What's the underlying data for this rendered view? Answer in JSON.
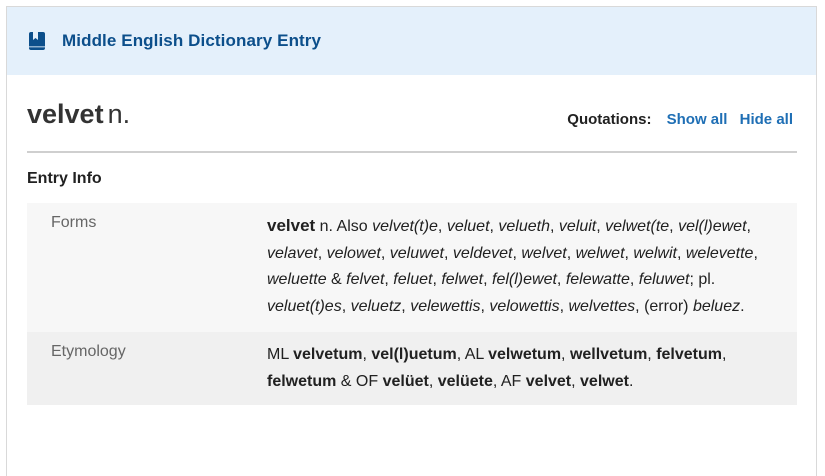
{
  "banner": {
    "title": "Middle English Dictionary Entry",
    "icon": "book-icon"
  },
  "entry": {
    "headword": "velvet",
    "pos": "n."
  },
  "quotations": {
    "label": "Quotations:",
    "show_all": "Show all",
    "hide_all": "Hide all"
  },
  "section": {
    "title": "Entry Info"
  },
  "forms": {
    "label": "Forms",
    "segments": [
      {
        "t": "velvet",
        "s": "hw"
      },
      {
        "t": " n. Also ",
        "s": "n"
      },
      {
        "t": "velvet(t)e",
        "s": "i"
      },
      {
        "t": ", ",
        "s": "n"
      },
      {
        "t": "veluet",
        "s": "i"
      },
      {
        "t": ", ",
        "s": "n"
      },
      {
        "t": "velueth",
        "s": "i"
      },
      {
        "t": ", ",
        "s": "n"
      },
      {
        "t": "veluit",
        "s": "i"
      },
      {
        "t": ", ",
        "s": "n"
      },
      {
        "t": "velwet(te",
        "s": "i"
      },
      {
        "t": ", ",
        "s": "n"
      },
      {
        "t": "vel(l)ewet",
        "s": "i"
      },
      {
        "t": ", ",
        "s": "n"
      },
      {
        "t": "velavet",
        "s": "i"
      },
      {
        "t": ", ",
        "s": "n"
      },
      {
        "t": "velowet",
        "s": "i"
      },
      {
        "t": ", ",
        "s": "n"
      },
      {
        "t": "veluwet",
        "s": "i"
      },
      {
        "t": ", ",
        "s": "n"
      },
      {
        "t": "veldevet",
        "s": "i"
      },
      {
        "t": ", ",
        "s": "n"
      },
      {
        "t": "welvet",
        "s": "i"
      },
      {
        "t": ", ",
        "s": "n"
      },
      {
        "t": "welwet",
        "s": "i"
      },
      {
        "t": ", ",
        "s": "n"
      },
      {
        "t": "welwit",
        "s": "i"
      },
      {
        "t": ", ",
        "s": "n"
      },
      {
        "t": "welevette",
        "s": "i"
      },
      {
        "t": ", ",
        "s": "n"
      },
      {
        "t": "weluette",
        "s": "i"
      },
      {
        "t": " & ",
        "s": "n"
      },
      {
        "t": "felvet",
        "s": "i"
      },
      {
        "t": ", ",
        "s": "n"
      },
      {
        "t": "feluet",
        "s": "i"
      },
      {
        "t": ", ",
        "s": "n"
      },
      {
        "t": "felwet",
        "s": "i"
      },
      {
        "t": ", ",
        "s": "n"
      },
      {
        "t": "fel(l)ewet",
        "s": "i"
      },
      {
        "t": ", ",
        "s": "n"
      },
      {
        "t": "felewatte",
        "s": "i"
      },
      {
        "t": ", ",
        "s": "n"
      },
      {
        "t": "feluwet",
        "s": "i"
      },
      {
        "t": "; pl. ",
        "s": "n"
      },
      {
        "t": "veluet(t)es",
        "s": "i"
      },
      {
        "t": ", ",
        "s": "n"
      },
      {
        "t": "veluetz",
        "s": "i"
      },
      {
        "t": ", ",
        "s": "n"
      },
      {
        "t": "velewettis",
        "s": "i"
      },
      {
        "t": ", ",
        "s": "n"
      },
      {
        "t": "velowettis",
        "s": "i"
      },
      {
        "t": ", ",
        "s": "n"
      },
      {
        "t": "welvettes",
        "s": "i"
      },
      {
        "t": ", (error) ",
        "s": "n"
      },
      {
        "t": "beluez",
        "s": "i"
      },
      {
        "t": ".",
        "s": "n"
      }
    ]
  },
  "etymology": {
    "label": "Etymology",
    "segments": [
      {
        "t": "ML ",
        "s": "n"
      },
      {
        "t": "velvetum",
        "s": "b"
      },
      {
        "t": ", ",
        "s": "n"
      },
      {
        "t": "vel(l)uetum",
        "s": "b"
      },
      {
        "t": ", AL ",
        "s": "n"
      },
      {
        "t": "velwetum",
        "s": "b"
      },
      {
        "t": ", ",
        "s": "n"
      },
      {
        "t": "wellvetum",
        "s": "b"
      },
      {
        "t": ", ",
        "s": "n"
      },
      {
        "t": "felvetum",
        "s": "b"
      },
      {
        "t": ", ",
        "s": "n"
      },
      {
        "t": "felwetum",
        "s": "b"
      },
      {
        "t": " & OF ",
        "s": "n"
      },
      {
        "t": "velüet",
        "s": "b"
      },
      {
        "t": ", ",
        "s": "n"
      },
      {
        "t": "velüete",
        "s": "b"
      },
      {
        "t": ", AF ",
        "s": "n"
      },
      {
        "t": "velvet",
        "s": "b"
      },
      {
        "t": ", ",
        "s": "n"
      },
      {
        "t": "velwet",
        "s": "b"
      },
      {
        "t": ".",
        "s": "n"
      }
    ]
  },
  "colors": {
    "banner_bg": "#e4f0fb",
    "banner_text": "#0c4f8b",
    "link": "#1f6fb5"
  }
}
